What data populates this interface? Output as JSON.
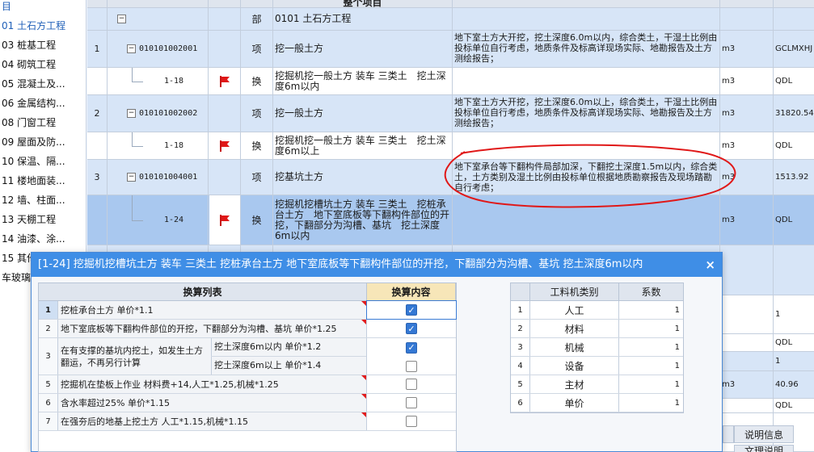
{
  "tree": {
    "items": [
      {
        "label": "目",
        "active": true
      },
      {
        "label": "01 土石方工程",
        "active": true
      },
      {
        "label": "03 桩基工程",
        "active": false
      },
      {
        "label": "04 砌筑工程",
        "active": false
      },
      {
        "label": "05 混凝土及...",
        "active": false
      },
      {
        "label": "06 金属结构...",
        "active": false
      },
      {
        "label": "08 门窗工程",
        "active": false
      },
      {
        "label": "09 屋面及防...",
        "active": false
      },
      {
        "label": "10 保温、隔...",
        "active": false
      },
      {
        "label": "11 楼地面装...",
        "active": false
      },
      {
        "label": "12 墙、柱面...",
        "active": false
      },
      {
        "label": "13 天棚工程",
        "active": false
      },
      {
        "label": "14 油漆、涂...",
        "active": false
      },
      {
        "label": "15 其他",
        "active": false
      },
      {
        "label": "车玻璃钢",
        "active": false
      }
    ]
  },
  "grid": {
    "header_partial": "整个项目",
    "rows": [
      {
        "seq": "",
        "code": "",
        "flag": false,
        "category": "部",
        "name": "0101 土石方工程",
        "features": "",
        "unit": "",
        "qty": "",
        "style": "blue"
      },
      {
        "seq": "1",
        "code": "010101002001",
        "flag": false,
        "category": "项",
        "name": "挖一般土方",
        "features": "地下室土方大开挖，挖土深度6.0m以内，综合类土，干湿土比例由投标单位自行考虑，地质条件及标高详现场实际、地勘报告及土方测绘报告；",
        "unit": "m3",
        "qty": "GCLMXHJ",
        "style": "blue"
      },
      {
        "seq": "",
        "code": "1-18",
        "flag": true,
        "category": "换",
        "name": "挖掘机挖一般土方 装车 三类土　挖土深度6m以内",
        "features": "",
        "unit": "m3",
        "qty": "QDL",
        "style": "white"
      },
      {
        "seq": "2",
        "code": "010101002002",
        "flag": false,
        "category": "项",
        "name": "挖一般土方",
        "features": "地下室土方大开挖，挖土深度6.0m以上，综合类土，干湿土比例由投标单位自行考虑，地质条件及标高详现场实际、地勘报告及土方测绘报告；",
        "unit": "m3",
        "qty": "31820.54",
        "style": "blue"
      },
      {
        "seq": "",
        "code": "1-18",
        "flag": true,
        "category": "换",
        "name": "挖掘机挖一般土方 装车 三类土　挖土深度6m以上",
        "features": "",
        "unit": "m3",
        "qty": "QDL",
        "style": "white"
      },
      {
        "seq": "3",
        "code": "010101004001",
        "flag": false,
        "category": "项",
        "name": "挖基坑土方",
        "features": "地下室承台等下翻构件局部加深，下翻挖土深度1.5m以内，综合类土，土方类别及湿土比例由投标单位根据地质勘察报告及现场踏勘自行考虑；",
        "unit": "m3",
        "qty": "1513.92",
        "style": "blue"
      },
      {
        "seq": "",
        "code": "1-24",
        "flag": true,
        "category": "换",
        "name": "挖掘机挖槽坑土方 装车 三类土　挖桩承台土方　地下室底板等下翻构件部位的开挖，下翻部分为沟槽、基坑　挖土深度6m以内",
        "features": "",
        "unit": "m3",
        "qty": "QDL",
        "style": "sel"
      }
    ],
    "below_dialog_values": [
      "1",
      "QDL",
      "1",
      "40.96",
      "QDL"
    ],
    "below_dialog_units": [
      "m3"
    ]
  },
  "bottom_tabs": {
    "info": "说明信息",
    "partial": "文理说明"
  },
  "dialog": {
    "title": "[1-24] 挖掘机挖槽坑土方 装车 三类土 挖桩承台土方 地下室底板等下翻构件部位的开挖，下翻部分为沟槽、基坑 挖土深度6m以内",
    "close": "×",
    "conv_header_list": "换算列表",
    "conv_header_content": "换算内容",
    "conversions": [
      {
        "num": "1",
        "text": "挖桩承台土方 单价*1.1",
        "checked": true
      },
      {
        "num": "2",
        "text": "地下室底板等下翻构件部位的开挖，下翻部分为沟槽、基坑 单价*1.25",
        "checked": true
      },
      {
        "num": "3",
        "text_main": "在有支撑的基坑内挖土，如发生土方翻运，不再另行计算",
        "sub_a": "挖土深度6m以内 单价*1.2",
        "sub_b": "挖土深度6m以上 单价*1.4",
        "checked_a": true,
        "checked_b": false
      },
      {
        "num": "5",
        "text": "挖掘机在垫板上作业 材料费+14,人工*1.25,机械*1.25",
        "checked": false
      },
      {
        "num": "6",
        "text": "含水率超过25% 单价*1.15",
        "checked": false
      },
      {
        "num": "7",
        "text": "在强夯后的地基上挖土方 人工*1.15,机械*1.15",
        "checked": false
      }
    ],
    "mat_header_type": "工料机类别",
    "mat_header_coef": "系数",
    "materials": [
      {
        "num": "1",
        "name": "人工",
        "coef": "1"
      },
      {
        "num": "2",
        "name": "材料",
        "coef": "1"
      },
      {
        "num": "3",
        "name": "机械",
        "coef": "1"
      },
      {
        "num": "4",
        "name": "设备",
        "coef": "1"
      },
      {
        "num": "5",
        "name": "主材",
        "coef": "1"
      },
      {
        "num": "6",
        "name": "单价",
        "coef": "1"
      }
    ]
  }
}
